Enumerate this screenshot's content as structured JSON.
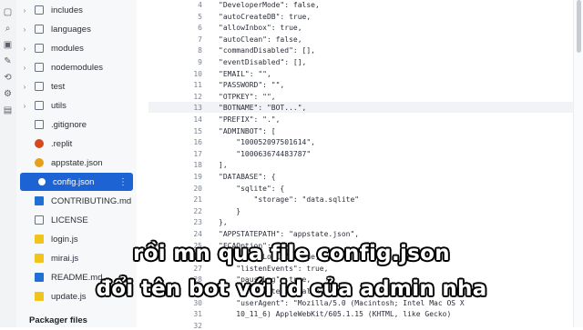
{
  "sidebar": {
    "items": [
      {
        "label": "includes",
        "type": "folder"
      },
      {
        "label": "languages",
        "type": "folder"
      },
      {
        "label": "modules",
        "type": "folder"
      },
      {
        "label": "nodemodules",
        "type": "folder"
      },
      {
        "label": "test",
        "type": "folder"
      },
      {
        "label": "utils",
        "type": "folder"
      },
      {
        "label": ".gitignore",
        "type": "file"
      },
      {
        "label": ".replit",
        "type": "replit"
      },
      {
        "label": "appstate.json",
        "type": "json"
      },
      {
        "label": "config.json",
        "type": "json",
        "selected": true
      },
      {
        "label": "CONTRIBUTING.md",
        "type": "md"
      },
      {
        "label": "LICENSE",
        "type": "file"
      },
      {
        "label": "login.js",
        "type": "js"
      },
      {
        "label": "mirai.js",
        "type": "js"
      },
      {
        "label": "README.md",
        "type": "md"
      },
      {
        "label": "update.js",
        "type": "js"
      }
    ],
    "packager_title": "Packager files",
    "kebab": "⋮"
  },
  "editor": {
    "line_numbers": [
      "4",
      "5",
      "6",
      "7",
      "8",
      "9",
      "10",
      "11",
      "12",
      "13",
      "14",
      "15",
      "16",
      "17",
      "18",
      "19",
      "20",
      "21",
      "22",
      "23",
      "24",
      "25",
      "26",
      "27",
      "28",
      "29",
      "30",
      "31",
      "32"
    ],
    "lines": [
      "\"DeveloperMode\": false,",
      "\"autoCreateDB\": true,",
      "\"allowInbox\": true,",
      "\"autoClean\": false,",
      "\"commandDisabled\": [],",
      "\"eventDisabled\": [],",
      "\"EMAIL\": \"\",",
      "\"PASSWORD\": \"\",",
      "\"OTPKEY\": \"\",",
      "\"BOTNAME\": \"BOT...\",",
      "\"PREFIX\": \".\",",
      "\"ADMINBOT\": [",
      "    \"100052097501614\",",
      "    \"100063674483787\"",
      "],",
      "\"DATABASE\": {",
      "    \"sqlite\": {",
      "        \"storage\": \"data.sqlite\"",
      "    }",
      "},",
      "\"APPSTATEPATH\": \"appstate.json\",",
      "\"FCAOption\": {",
      "    \"forceLogin\": true,",
      "    \"listenEvents\": true,",
      "    \"pauseLog\": true,",
      "    \"selfListen\": false,",
      "    \"userAgent\": \"Mozilla/5.0 (Macintosh; Intel Mac OS X",
      "    10_11_6) AppleWebKit/605.1.15 (KHTML, like Gecko)",
      ""
    ]
  },
  "caption": {
    "line1": "rồi mn qua file config.json",
    "line2": "đổi tên bot với id của admin nha"
  }
}
